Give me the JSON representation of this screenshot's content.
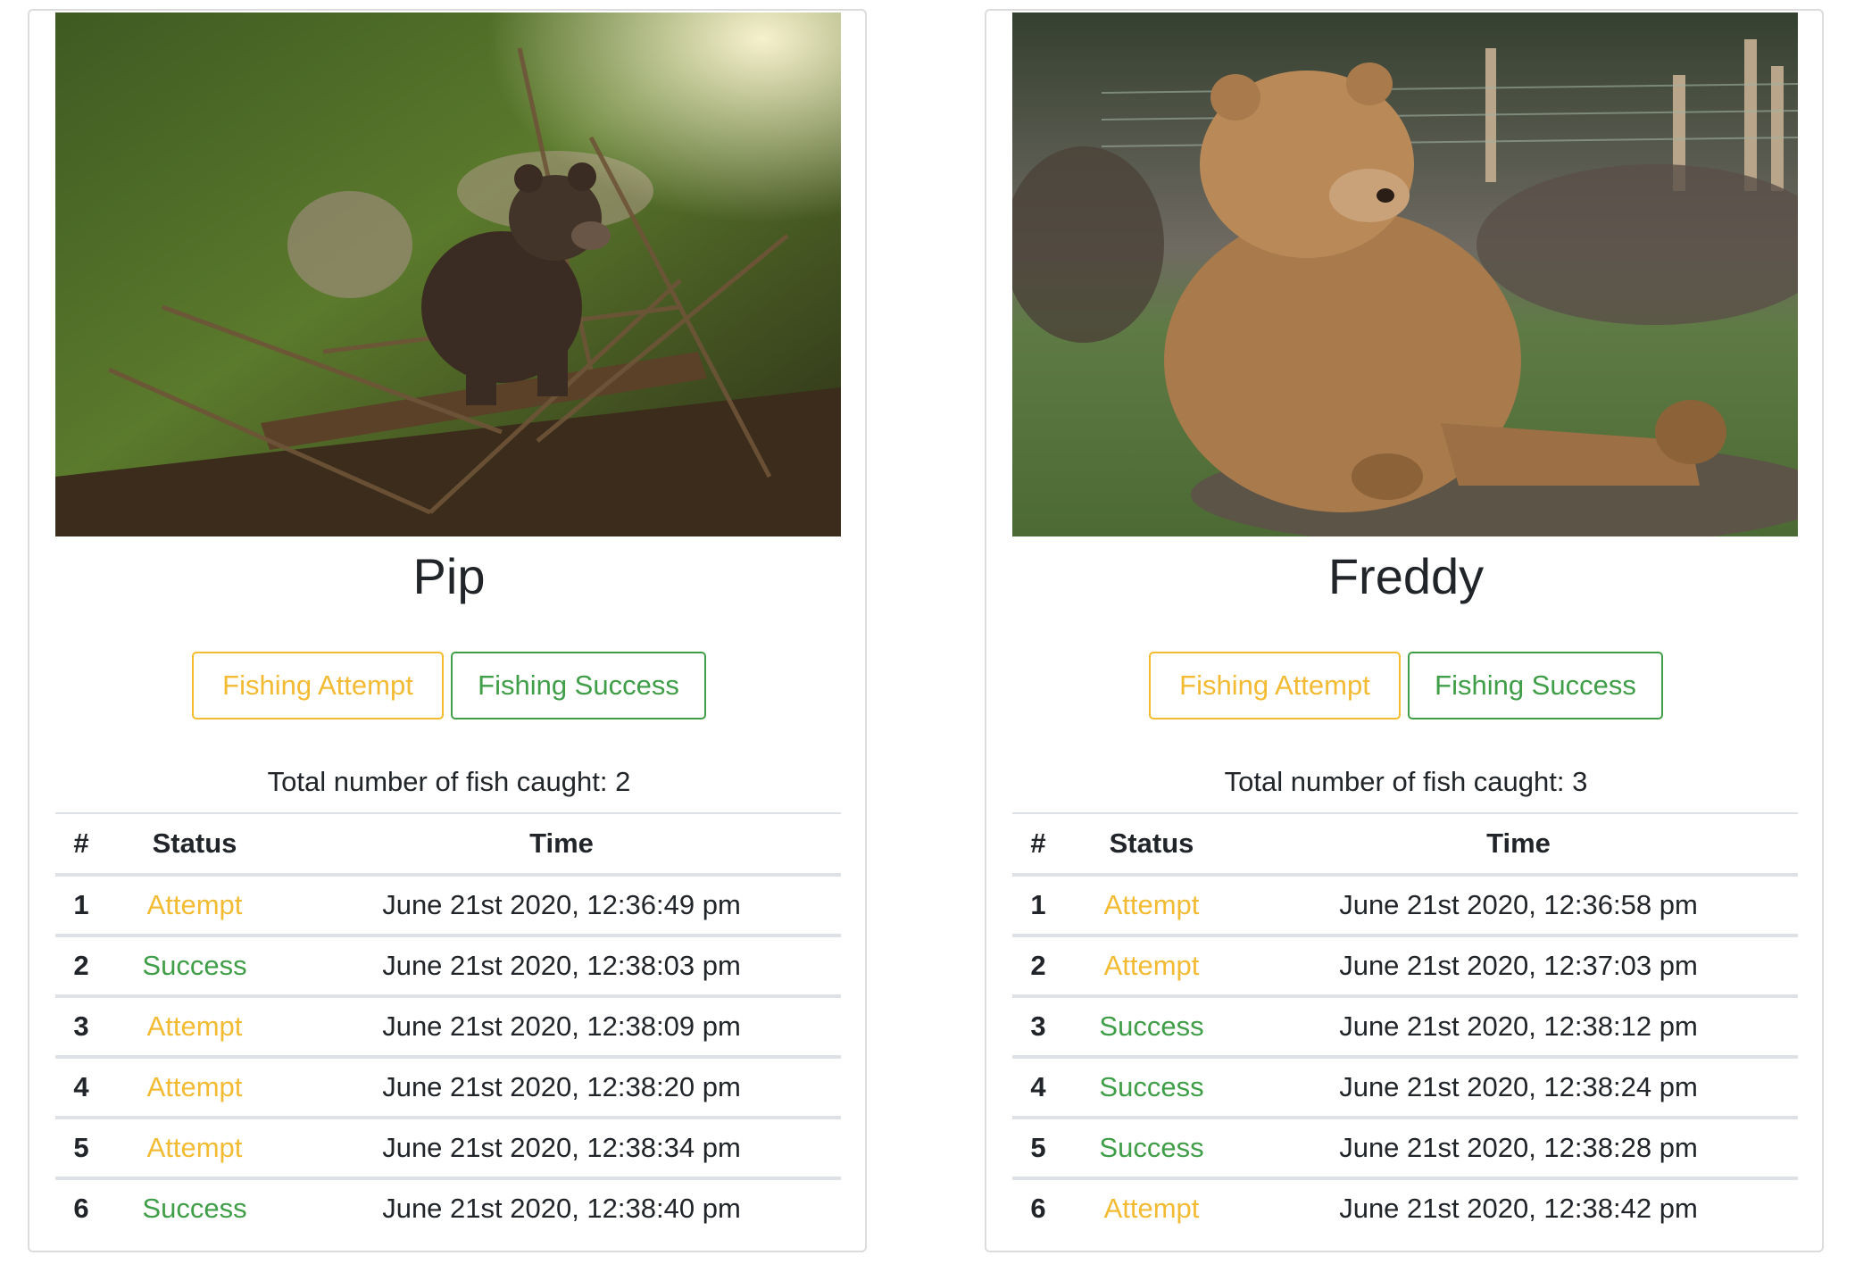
{
  "colors": {
    "attempt": "#f3bb33",
    "success": "#3f9e47",
    "text": "#212529",
    "divider": "#dee2e6"
  },
  "table_headers": {
    "num": "#",
    "status": "Status",
    "time": "Time"
  },
  "bears": [
    {
      "name": "Pip",
      "photo": "bear-cub-photo",
      "attempt_button": "Fishing Attempt",
      "success_button": "Fishing Success",
      "total_text": "Total number of fish caught: 2",
      "rows": [
        {
          "num": "1",
          "status": "Attempt",
          "time": "June 21st 2020, 12:36:49 pm"
        },
        {
          "num": "2",
          "status": "Success",
          "time": "June 21st 2020, 12:38:03 pm"
        },
        {
          "num": "3",
          "status": "Attempt",
          "time": "June 21st 2020, 12:38:09 pm"
        },
        {
          "num": "4",
          "status": "Attempt",
          "time": "June 21st 2020, 12:38:20 pm"
        },
        {
          "num": "5",
          "status": "Attempt",
          "time": "June 21st 2020, 12:38:34 pm"
        },
        {
          "num": "6",
          "status": "Success",
          "time": "June 21st 2020, 12:38:40 pm"
        }
      ]
    },
    {
      "name": "Freddy",
      "photo": "sitting-bear-photo",
      "attempt_button": "Fishing Attempt",
      "success_button": "Fishing Success",
      "total_text": "Total number of fish caught: 3",
      "rows": [
        {
          "num": "1",
          "status": "Attempt",
          "time": "June 21st 2020, 12:36:58 pm"
        },
        {
          "num": "2",
          "status": "Attempt",
          "time": "June 21st 2020, 12:37:03 pm"
        },
        {
          "num": "3",
          "status": "Success",
          "time": "June 21st 2020, 12:38:12 pm"
        },
        {
          "num": "4",
          "status": "Success",
          "time": "June 21st 2020, 12:38:24 pm"
        },
        {
          "num": "5",
          "status": "Success",
          "time": "June 21st 2020, 12:38:28 pm"
        },
        {
          "num": "6",
          "status": "Attempt",
          "time": "June 21st 2020, 12:38:42 pm"
        }
      ]
    }
  ]
}
